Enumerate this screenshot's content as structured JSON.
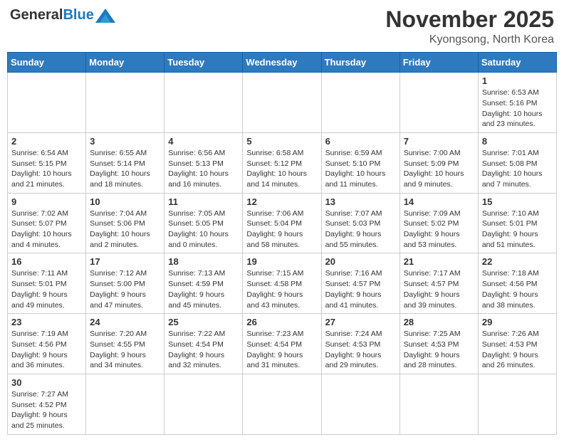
{
  "logo": {
    "general": "General",
    "blue": "Blue"
  },
  "title": {
    "month": "November 2025",
    "location": "Kyongsong, North Korea"
  },
  "weekdays": [
    "Sunday",
    "Monday",
    "Tuesday",
    "Wednesday",
    "Thursday",
    "Friday",
    "Saturday"
  ],
  "weeks": [
    [
      {
        "day": "",
        "info": ""
      },
      {
        "day": "",
        "info": ""
      },
      {
        "day": "",
        "info": ""
      },
      {
        "day": "",
        "info": ""
      },
      {
        "day": "",
        "info": ""
      },
      {
        "day": "",
        "info": ""
      },
      {
        "day": "1",
        "info": "Sunrise: 6:53 AM\nSunset: 5:16 PM\nDaylight: 10 hours\nand 23 minutes."
      }
    ],
    [
      {
        "day": "2",
        "info": "Sunrise: 6:54 AM\nSunset: 5:15 PM\nDaylight: 10 hours\nand 21 minutes."
      },
      {
        "day": "3",
        "info": "Sunrise: 6:55 AM\nSunset: 5:14 PM\nDaylight: 10 hours\nand 18 minutes."
      },
      {
        "day": "4",
        "info": "Sunrise: 6:56 AM\nSunset: 5:13 PM\nDaylight: 10 hours\nand 16 minutes."
      },
      {
        "day": "5",
        "info": "Sunrise: 6:58 AM\nSunset: 5:12 PM\nDaylight: 10 hours\nand 14 minutes."
      },
      {
        "day": "6",
        "info": "Sunrise: 6:59 AM\nSunset: 5:10 PM\nDaylight: 10 hours\nand 11 minutes."
      },
      {
        "day": "7",
        "info": "Sunrise: 7:00 AM\nSunset: 5:09 PM\nDaylight: 10 hours\nand 9 minutes."
      },
      {
        "day": "8",
        "info": "Sunrise: 7:01 AM\nSunset: 5:08 PM\nDaylight: 10 hours\nand 7 minutes."
      }
    ],
    [
      {
        "day": "9",
        "info": "Sunrise: 7:02 AM\nSunset: 5:07 PM\nDaylight: 10 hours\nand 4 minutes."
      },
      {
        "day": "10",
        "info": "Sunrise: 7:04 AM\nSunset: 5:06 PM\nDaylight: 10 hours\nand 2 minutes."
      },
      {
        "day": "11",
        "info": "Sunrise: 7:05 AM\nSunset: 5:05 PM\nDaylight: 10 hours\nand 0 minutes."
      },
      {
        "day": "12",
        "info": "Sunrise: 7:06 AM\nSunset: 5:04 PM\nDaylight: 9 hours\nand 58 minutes."
      },
      {
        "day": "13",
        "info": "Sunrise: 7:07 AM\nSunset: 5:03 PM\nDaylight: 9 hours\nand 55 minutes."
      },
      {
        "day": "14",
        "info": "Sunrise: 7:09 AM\nSunset: 5:02 PM\nDaylight: 9 hours\nand 53 minutes."
      },
      {
        "day": "15",
        "info": "Sunrise: 7:10 AM\nSunset: 5:01 PM\nDaylight: 9 hours\nand 51 minutes."
      }
    ],
    [
      {
        "day": "16",
        "info": "Sunrise: 7:11 AM\nSunset: 5:01 PM\nDaylight: 9 hours\nand 49 minutes."
      },
      {
        "day": "17",
        "info": "Sunrise: 7:12 AM\nSunset: 5:00 PM\nDaylight: 9 hours\nand 47 minutes."
      },
      {
        "day": "18",
        "info": "Sunrise: 7:13 AM\nSunset: 4:59 PM\nDaylight: 9 hours\nand 45 minutes."
      },
      {
        "day": "19",
        "info": "Sunrise: 7:15 AM\nSunset: 4:58 PM\nDaylight: 9 hours\nand 43 minutes."
      },
      {
        "day": "20",
        "info": "Sunrise: 7:16 AM\nSunset: 4:57 PM\nDaylight: 9 hours\nand 41 minutes."
      },
      {
        "day": "21",
        "info": "Sunrise: 7:17 AM\nSunset: 4:57 PM\nDaylight: 9 hours\nand 39 minutes."
      },
      {
        "day": "22",
        "info": "Sunrise: 7:18 AM\nSunset: 4:56 PM\nDaylight: 9 hours\nand 38 minutes."
      }
    ],
    [
      {
        "day": "23",
        "info": "Sunrise: 7:19 AM\nSunset: 4:56 PM\nDaylight: 9 hours\nand 36 minutes."
      },
      {
        "day": "24",
        "info": "Sunrise: 7:20 AM\nSunset: 4:55 PM\nDaylight: 9 hours\nand 34 minutes."
      },
      {
        "day": "25",
        "info": "Sunrise: 7:22 AM\nSunset: 4:54 PM\nDaylight: 9 hours\nand 32 minutes."
      },
      {
        "day": "26",
        "info": "Sunrise: 7:23 AM\nSunset: 4:54 PM\nDaylight: 9 hours\nand 31 minutes."
      },
      {
        "day": "27",
        "info": "Sunrise: 7:24 AM\nSunset: 4:53 PM\nDaylight: 9 hours\nand 29 minutes."
      },
      {
        "day": "28",
        "info": "Sunrise: 7:25 AM\nSunset: 4:53 PM\nDaylight: 9 hours\nand 28 minutes."
      },
      {
        "day": "29",
        "info": "Sunrise: 7:26 AM\nSunset: 4:53 PM\nDaylight: 9 hours\nand 26 minutes."
      }
    ],
    [
      {
        "day": "30",
        "info": "Sunrise: 7:27 AM\nSunset: 4:52 PM\nDaylight: 9 hours\nand 25 minutes."
      },
      {
        "day": "",
        "info": ""
      },
      {
        "day": "",
        "info": ""
      },
      {
        "day": "",
        "info": ""
      },
      {
        "day": "",
        "info": ""
      },
      {
        "day": "",
        "info": ""
      },
      {
        "day": "",
        "info": ""
      }
    ]
  ]
}
